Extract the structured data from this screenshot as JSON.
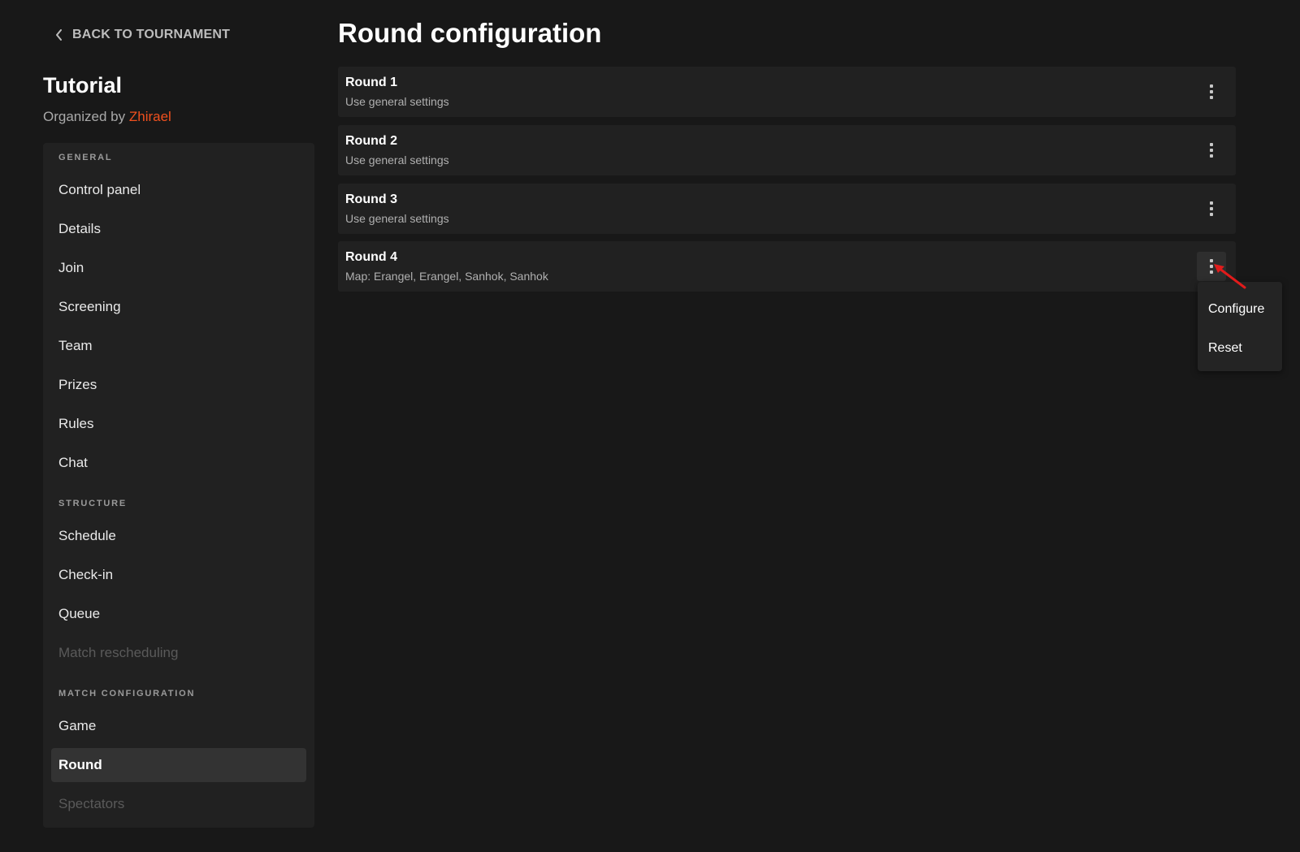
{
  "back_link": {
    "label": "BACK TO TOURNAMENT",
    "icon": "chevron-left-icon"
  },
  "tournament": {
    "title": "Tutorial",
    "organized_by_label": "Organized by",
    "organizer_name": "Zhirael"
  },
  "sidebar": {
    "sections": [
      {
        "label": "GENERAL",
        "items": [
          {
            "label": "Control panel",
            "state": "normal"
          },
          {
            "label": "Details",
            "state": "normal"
          },
          {
            "label": "Join",
            "state": "normal"
          },
          {
            "label": "Screening",
            "state": "normal"
          },
          {
            "label": "Team",
            "state": "normal"
          },
          {
            "label": "Prizes",
            "state": "normal"
          },
          {
            "label": "Rules",
            "state": "normal"
          },
          {
            "label": "Chat",
            "state": "normal"
          }
        ]
      },
      {
        "label": "STRUCTURE",
        "items": [
          {
            "label": "Schedule",
            "state": "normal"
          },
          {
            "label": "Check-in",
            "state": "normal"
          },
          {
            "label": "Queue",
            "state": "normal"
          },
          {
            "label": "Match rescheduling",
            "state": "disabled"
          }
        ]
      },
      {
        "label": "MATCH CONFIGURATION",
        "items": [
          {
            "label": "Game",
            "state": "normal"
          },
          {
            "label": "Round",
            "state": "active"
          },
          {
            "label": "Spectators",
            "state": "disabled"
          }
        ]
      }
    ]
  },
  "main": {
    "title": "Round configuration",
    "rounds": [
      {
        "name": "Round 1",
        "description": "Use general settings"
      },
      {
        "name": "Round 2",
        "description": "Use general settings"
      },
      {
        "name": "Round 3",
        "description": "Use general settings"
      },
      {
        "name": "Round 4",
        "description": "Map: Erangel, Erangel, Sanhok, Sanhok"
      }
    ],
    "more_icon": "more-vertical-icon",
    "dropdown": {
      "items": [
        {
          "label": "Configure"
        },
        {
          "label": "Reset"
        }
      ]
    }
  },
  "colors": {
    "background": "#181818",
    "panel": "#212121",
    "accent": "#f0501e",
    "active_item": "#333333",
    "annotation_arrow": "#e01b1b"
  }
}
